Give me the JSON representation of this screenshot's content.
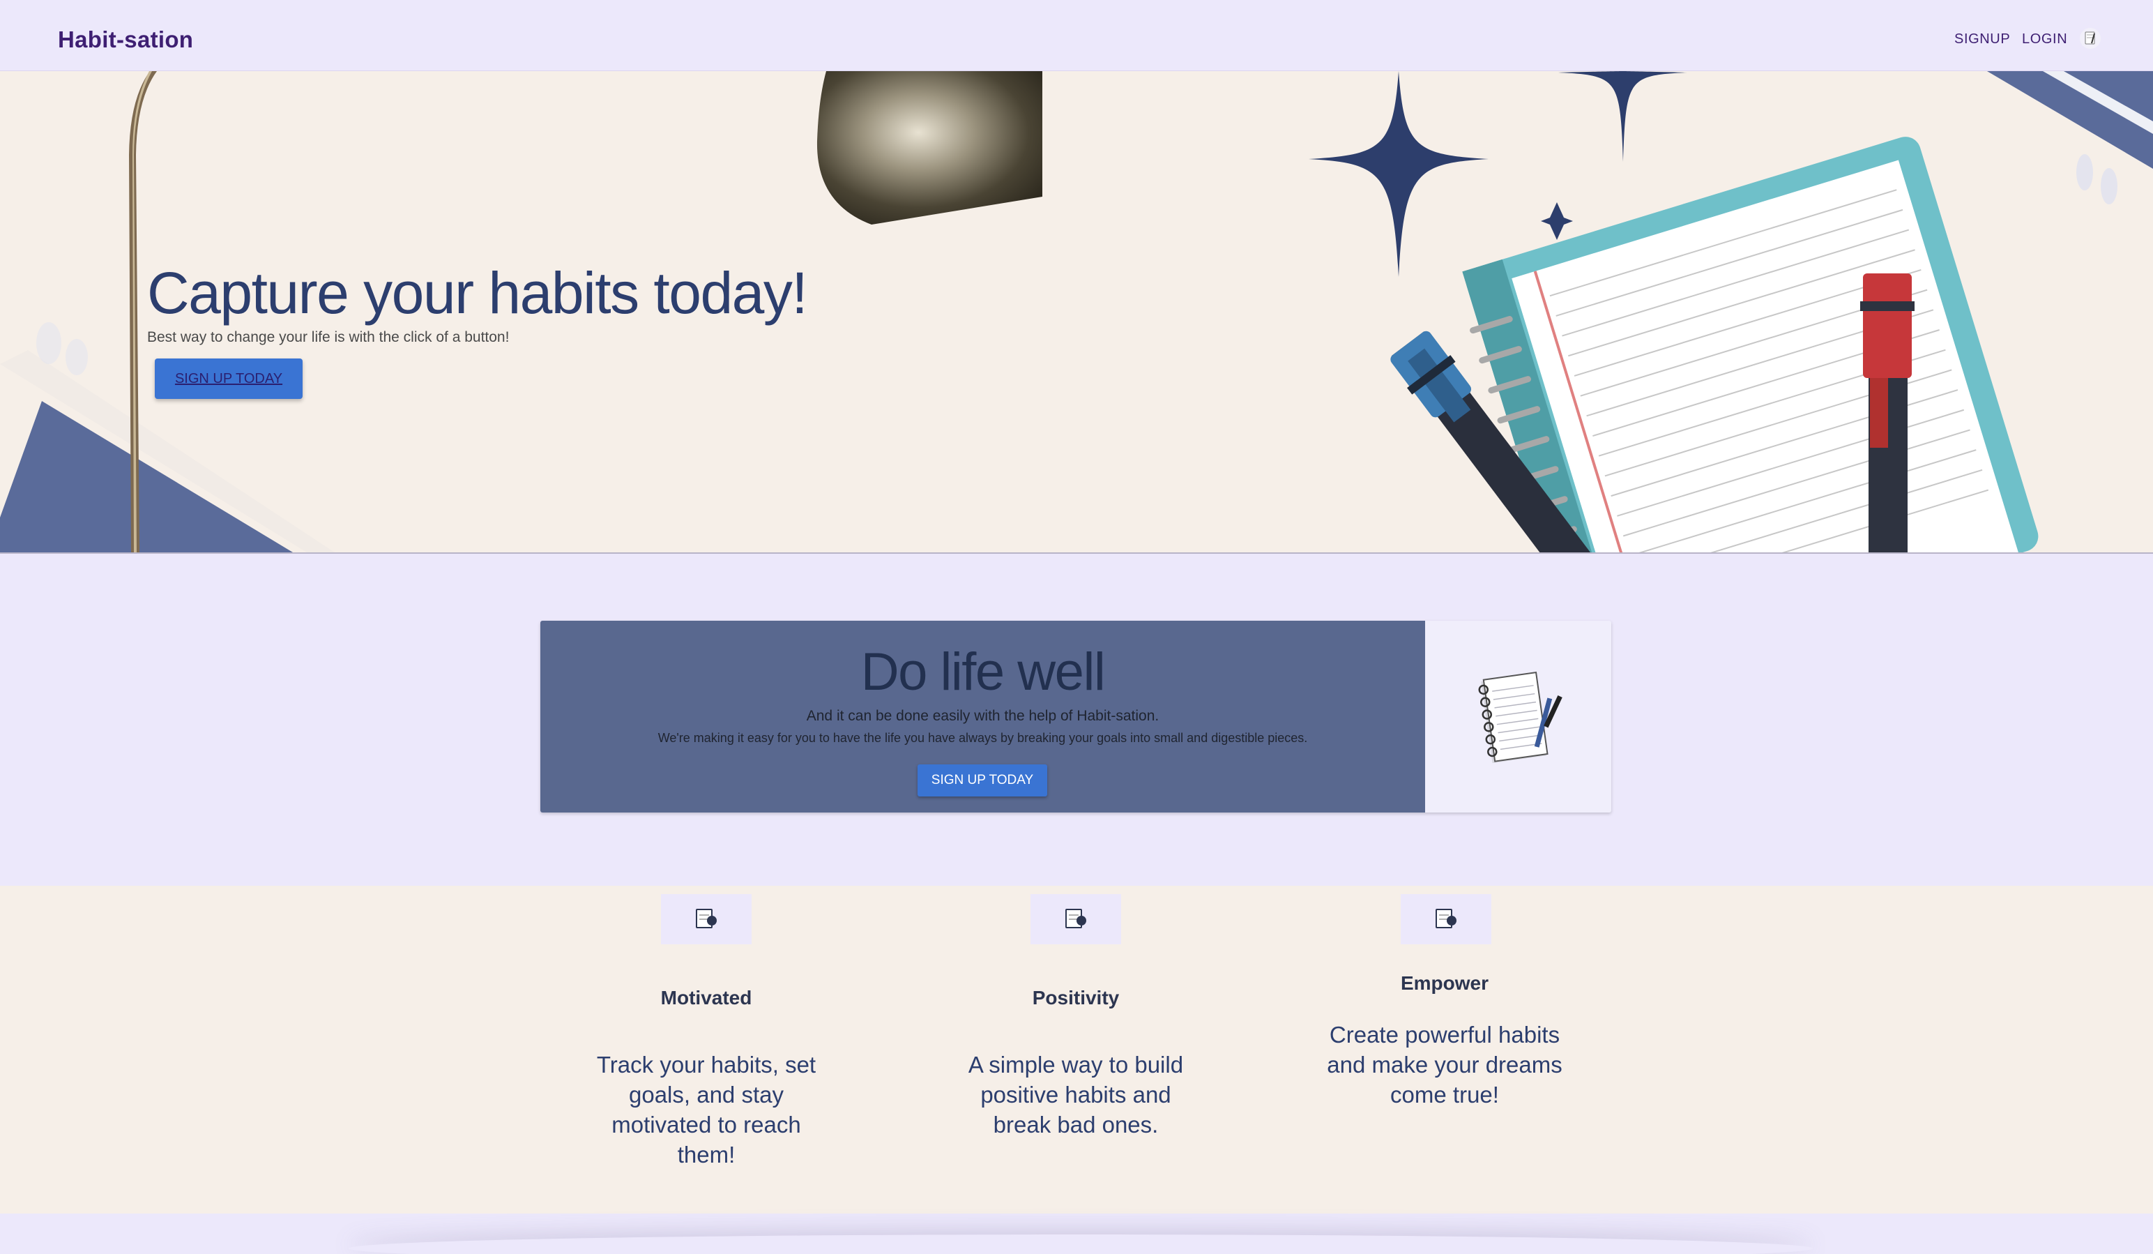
{
  "navbar": {
    "brand": "Habit-sation",
    "signup": "SIGNUP",
    "login": "LOGIN"
  },
  "hero": {
    "title": "Capture your habits today!",
    "subtitle": "Best way to change your life is with the click of a button!",
    "button": "SIGN UP TODAY"
  },
  "cta": {
    "title": "Do life well",
    "subtitle": "And it can be done easily with the help of Habit-sation.",
    "description": "We're making it easy for you to have the life you have always by breaking your goals into small and digestible pieces.",
    "button": "SIGN UP TODAY"
  },
  "features": [
    {
      "title": "Motivated",
      "text": "Track your habits, set goals, and stay motivated to reach them!",
      "icon": "notebook-icon"
    },
    {
      "title": "Positivity",
      "text": "A simple way to build positive habits and break bad ones.",
      "icon": "notebook-icon"
    },
    {
      "title": "Empower",
      "text": "Create powerful habits and make your dreams come true!",
      "icon": "notebook-icon"
    }
  ],
  "colors": {
    "brand": "#3e1f72",
    "accent": "#3a74d3",
    "hero_bg": "#f6efe8",
    "page_bg": "#ece8fb",
    "cta_panel": "#59688f"
  }
}
